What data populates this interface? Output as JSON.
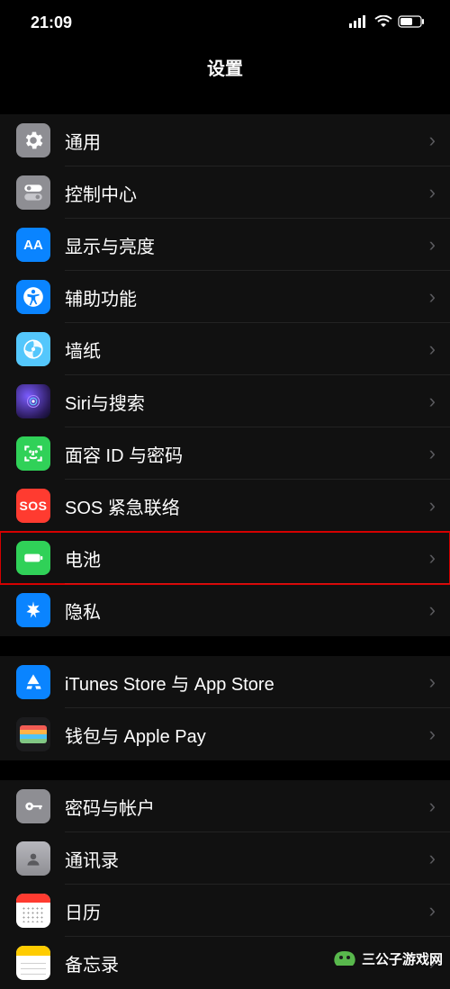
{
  "status": {
    "time": "21:09"
  },
  "header": {
    "title": "设置"
  },
  "sections": [
    {
      "rows": [
        {
          "id": "general",
          "label": "通用",
          "highlight": false
        },
        {
          "id": "control-center",
          "label": "控制中心",
          "highlight": false
        },
        {
          "id": "display",
          "label": "显示与亮度",
          "highlight": false
        },
        {
          "id": "accessibility",
          "label": "辅助功能",
          "highlight": false
        },
        {
          "id": "wallpaper",
          "label": "墙纸",
          "highlight": false
        },
        {
          "id": "siri",
          "label": "Siri与搜索",
          "highlight": false
        },
        {
          "id": "faceid",
          "label": "面容 ID 与密码",
          "highlight": false
        },
        {
          "id": "sos",
          "label": "SOS 紧急联络",
          "highlight": false
        },
        {
          "id": "battery",
          "label": "电池",
          "highlight": true
        },
        {
          "id": "privacy",
          "label": "隐私",
          "highlight": false
        }
      ]
    },
    {
      "rows": [
        {
          "id": "appstore",
          "label": "iTunes Store 与 App Store",
          "highlight": false
        },
        {
          "id": "wallet",
          "label": "钱包与 Apple Pay",
          "highlight": false
        }
      ]
    },
    {
      "rows": [
        {
          "id": "passwords",
          "label": "密码与帐户",
          "highlight": false
        },
        {
          "id": "contacts",
          "label": "通讯录",
          "highlight": false
        },
        {
          "id": "calendar",
          "label": "日历",
          "highlight": false
        },
        {
          "id": "notes",
          "label": "备忘录",
          "highlight": false
        }
      ]
    }
  ],
  "icons": {
    "sos_text": "SOS",
    "display_text": "AA"
  },
  "watermark": {
    "text": "三公子游戏网"
  }
}
